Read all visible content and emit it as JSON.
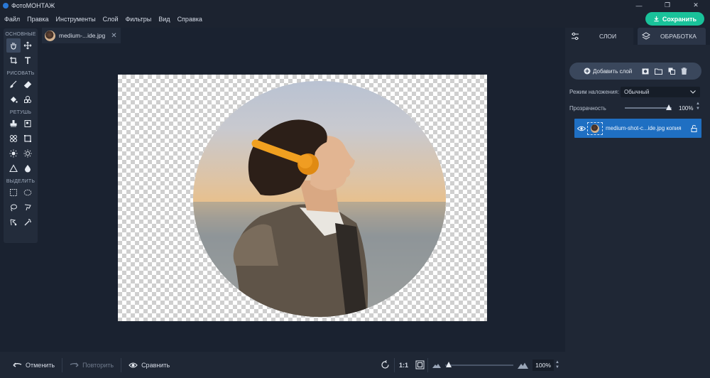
{
  "window": {
    "title": "ФотоМОНТАЖ"
  },
  "menu": [
    "Файл",
    "Правка",
    "Инструменты",
    "Слой",
    "Фильтры",
    "Вид",
    "Справка"
  ],
  "save_label": "Сохранить",
  "toolbox": {
    "basic": "ОСНОВНЫЕ",
    "draw": "РИСОВАТЬ",
    "retouch": "РЕТУШЬ",
    "select": "ВЫДЕЛИТЬ"
  },
  "document": {
    "tab_name": "medium-...ide.jpg"
  },
  "bottom": {
    "undo": "Отменить",
    "redo": "Повторить",
    "compare": "Сравнить",
    "ratio": "1:1",
    "zoom": "100%",
    "zoom_level": 0.05
  },
  "panel": {
    "tab_layers": "СЛОИ",
    "tab_processing": "ОБРАБОТКА",
    "add_layer": "Добавить слой",
    "blend_label": "Режим наложения:",
    "blend_value": "Обычный",
    "opacity_label": "Прозрачность",
    "opacity_value": "100%",
    "opacity_level": 1.0,
    "layer_name": "medium-shot-c...ide.jpg копия"
  },
  "colors": {
    "accent": "#19c29a",
    "selection": "#1f6fc2"
  }
}
